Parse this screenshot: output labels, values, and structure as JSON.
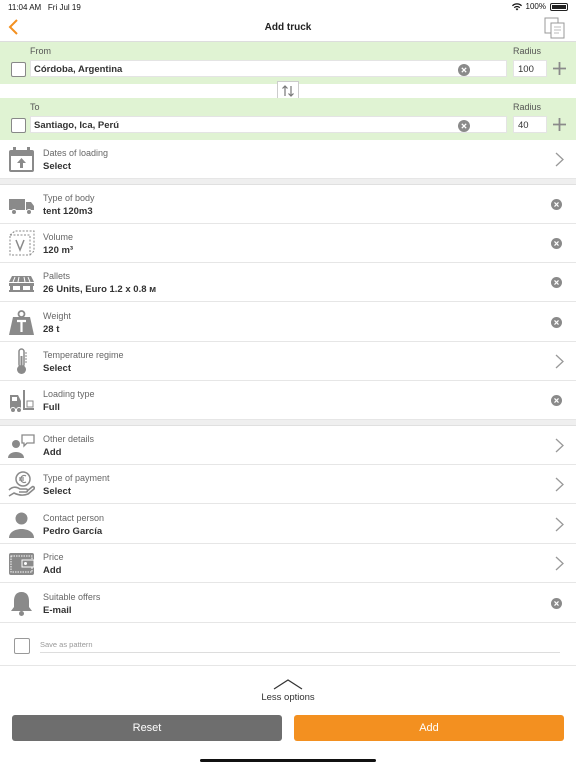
{
  "status": {
    "time": "11:04 AM",
    "date": "Fri Jul 19",
    "battery": "100%"
  },
  "nav": {
    "title": "Add truck"
  },
  "from": {
    "label": "From",
    "value": "Córdoba, Argentina",
    "radius_label": "Radius",
    "radius": "100"
  },
  "to": {
    "label": "To",
    "value": "Santiago, Ica, Perú",
    "radius_label": "Radius",
    "radius": "40"
  },
  "dates": {
    "label": "Dates of loading",
    "value": "Select"
  },
  "body_type": {
    "label": "Type of body",
    "value": "tent 120m3"
  },
  "volume": {
    "label": "Volume",
    "value": "120 m³"
  },
  "pallets": {
    "label": "Pallets",
    "value": "26 Units, Euro 1.2 x 0.8 м"
  },
  "weight": {
    "label": "Weight",
    "value": "28 t"
  },
  "temperature": {
    "label": "Temperature regime",
    "value": "Select"
  },
  "loading": {
    "label": "Loading type",
    "value": "Full"
  },
  "other": {
    "label": "Other details",
    "value": "Add"
  },
  "payment": {
    "label": "Type of payment",
    "value": "Select"
  },
  "contact": {
    "label": "Contact person",
    "value": "Pedro García"
  },
  "price": {
    "label": "Price",
    "value": "Add"
  },
  "offers": {
    "label": "Suitable offers",
    "value": "E-mail"
  },
  "pattern": {
    "label": "Save as pattern"
  },
  "less_options": "Less options",
  "buttons": {
    "reset": "Reset",
    "add": "Add"
  },
  "colors": {
    "accent": "#f39020",
    "route_bg": "#e0f3d3",
    "icon": "#8a8a8a",
    "reset": "#6e6e6e"
  }
}
